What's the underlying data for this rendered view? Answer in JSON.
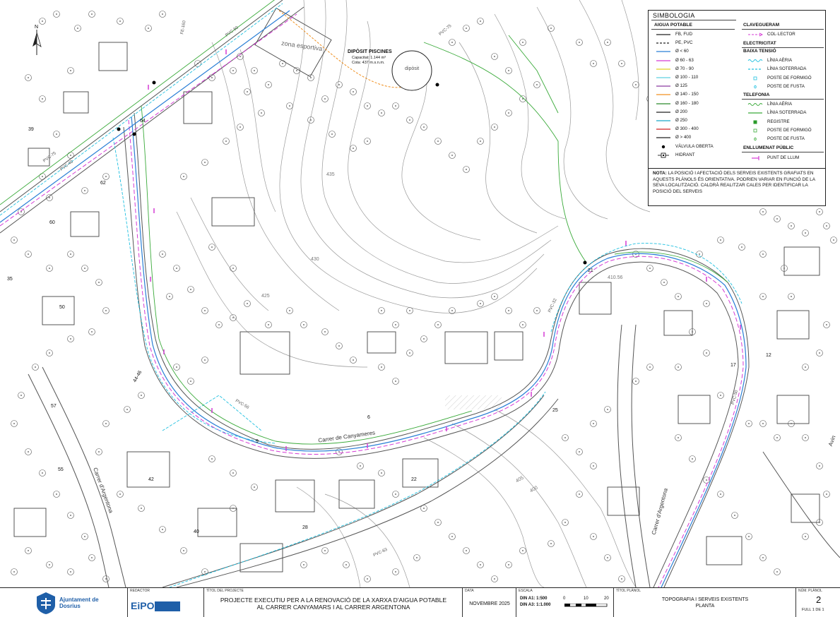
{
  "legend": {
    "title": "SIMBOLOGIA",
    "water": {
      "heading": "AIGUA POTABLE",
      "items": [
        {
          "label": "FB, FUD",
          "color": "#222222",
          "style": "solid"
        },
        {
          "label": "PE, PVC",
          "color": "#222222",
          "style": "dash"
        },
        {
          "label": "Ø < 60",
          "color": "#2a7fd6",
          "style": "solid"
        },
        {
          "label": "Ø 60 - 63",
          "color": "#d43ad4",
          "style": "solid"
        },
        {
          "label": "Ø 70 - 90",
          "color": "#e0d020",
          "style": "solid"
        },
        {
          "label": "Ø 100 - 110",
          "color": "#5fd0e0",
          "style": "solid"
        },
        {
          "label": "Ø 125",
          "color": "#8b3aa0",
          "style": "solid"
        },
        {
          "label": "Ø 140 - 150",
          "color": "#f09020",
          "style": "solid"
        },
        {
          "label": "Ø 160 - 180",
          "color": "#2a8a2a",
          "style": "solid"
        },
        {
          "label": "Ø 200",
          "color": "#222222",
          "style": "solid"
        },
        {
          "label": "Ø 250",
          "color": "#1aa8c8",
          "style": "solid"
        },
        {
          "label": "Ø 300 - 400",
          "color": "#d02020",
          "style": "solid"
        },
        {
          "label": "Ø > 400",
          "color": "#222222",
          "style": "solid"
        },
        {
          "label": "VÀLVULA OBERTA",
          "color": "#000000",
          "style": "dot"
        },
        {
          "label": "HIDRANT",
          "color": "#000000",
          "style": "hydrant"
        }
      ]
    },
    "sewer": {
      "heading": "CLAVEGUERAM",
      "items": [
        {
          "label": "COL·LECTOR",
          "color": "#d43ad4",
          "style": "dasharrow"
        }
      ]
    },
    "electric": {
      "heading": "ELECTRICITAT",
      "sub": "BAIXA TENSIÓ",
      "items": [
        {
          "label": "LÍNIA AÈRIA",
          "color": "#20c0e0",
          "style": "wave"
        },
        {
          "label": "LÍNIA SOTERRADA",
          "color": "#20c0e0",
          "style": "dash"
        },
        {
          "label": "POSTE DE FORMIGÓ",
          "color": "#20c0e0",
          "style": "square"
        },
        {
          "label": "POSTE DE FUSTA",
          "color": "#20c0e0",
          "style": "cross"
        }
      ]
    },
    "telecom": {
      "heading": "TELEFONIA",
      "items": [
        {
          "label": "LÍNIA AÈRIA",
          "color": "#3aaa3a",
          "style": "wave"
        },
        {
          "label": "LÍNIA SOTERRADA",
          "color": "#3aaa3a",
          "style": "solid"
        },
        {
          "label": "REGISTRE",
          "color": "#2a9a2a",
          "style": "filledsquare"
        },
        {
          "label": "POSTE DE FORMIGÓ",
          "color": "#3aaa3a",
          "style": "square"
        },
        {
          "label": "POSTE DE FUSTA",
          "color": "#3aaa3a",
          "style": "cross"
        }
      ]
    },
    "lighting": {
      "heading": "ENLLUMENAT PÚBLIC",
      "items": [
        {
          "label": "PUNT DE LLUM",
          "color": "#d43ad4",
          "style": "tick"
        }
      ]
    }
  },
  "note": {
    "prefix": "NOTA:",
    "text": "LA POSICIÓ I AFECTACIÓ DELS SERVEIS EXISTENTS GRAFIATS EN AQUESTS PLÀNOLS ÉS ORIENTATIVA. PODRIEN VARIAR EN FUNCIÓ DE LA SEVA LOCALITZACIÓ. CALDRÀ REALITZAR CALES PER IDENTIFICAR LA POSICIÓ DEL SERVEIS"
  },
  "tank": {
    "title": "DIPÒSIT PISCINES",
    "capacity": "Capacitat: 1.144 m³",
    "level": "Cota: 437 m.s.n.m.",
    "inner": "dipòsit"
  },
  "map_labels": {
    "street_canyamars": "Carrer de Canyameres",
    "street_argentona_1": "Carrer d'Argentona",
    "street_argentona_2": "Carrer d'Argentona",
    "avinguda": "Avin",
    "zona": "zona esportiva",
    "contour_435": "435",
    "contour_430": "430",
    "contour_425": "425",
    "contour_410": "410.56",
    "contour_405": "405",
    "contour_400": "400",
    "pipe_pvc75_top": "PVC-75",
    "pipe_pvc75_side": "PVC-75",
    "pipe_pvc50_top": "PVC-50",
    "pipe_pvc50_right": "PVC-50",
    "pipe_pvc40": "PVC-40",
    "pipe_pvc56": "PVC-56",
    "pipe_pvc63": "PVC-63",
    "pipe_pvc32": "PVC-32",
    "pipe_fe": "FE-160",
    "num_42": "42",
    "num_50": "50",
    "num_60": "60",
    "num_62": "62",
    "num_64": "64",
    "num_35": "35",
    "num_25": "25",
    "num_22": "22",
    "num_28": "28",
    "num_12": "12",
    "num_21": "21",
    "num_6": "6",
    "num_9": "9",
    "num_39": "39",
    "num_40": "40",
    "num_17": "17",
    "num_57": "57",
    "num_44": "44-46",
    "num_55": "55"
  },
  "titleblock": {
    "logo": "Ajuntament de Dosrius",
    "redactor_label": "REDACTOR",
    "redactor": "EiPO",
    "project_label": "TÍTOL DEL PROJECTE",
    "project_line1": "PROJECTE EXECUTIU PER A LA RENOVACIÓ DE LA XARXA D'AIGUA POTABLE",
    "project_line2": "AL CARRER CANYAMARS I AL CARRER ARGENTONA",
    "date_label": "DATA",
    "date": "NOVEMBRE 2025",
    "scale_label": "ESCALA",
    "scale_a1": "DIN A1:  1:500",
    "scale_a3": "DIN A3:  1:1.000",
    "scale_ticks": [
      "0",
      "10",
      "20"
    ],
    "plan_title_label": "TÍTOL PLÀNOL",
    "plan_title_1": "TOPOGRAFIA I SERVEIS EXISTENTS",
    "plan_title_2": "PLANTA",
    "plan_num_label": "NÚM. PLÀNOL",
    "plan_num": "2",
    "sheet": "FULL  1  DE  1"
  }
}
